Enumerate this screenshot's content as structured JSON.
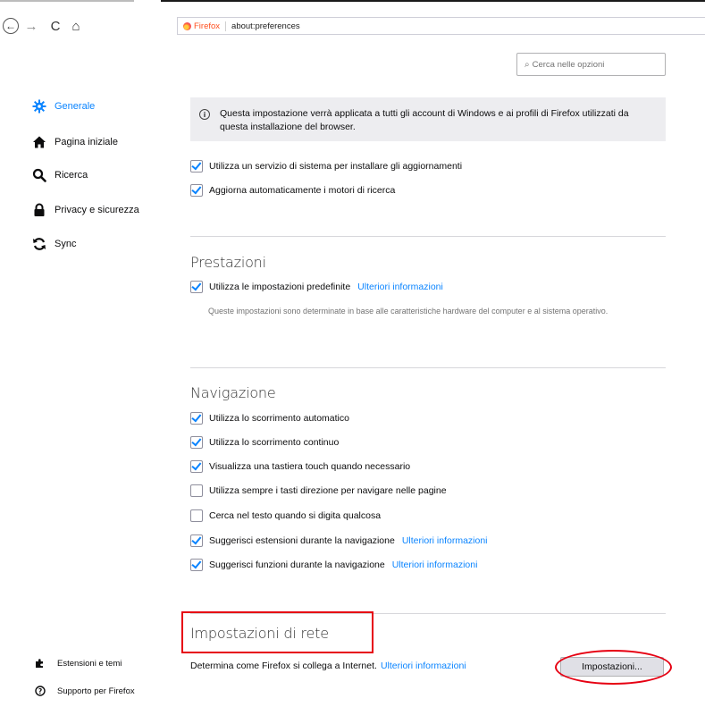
{
  "toolbar": {
    "back_glyph": "←",
    "forward_glyph": "→",
    "reload_glyph": "C",
    "home_glyph": "⌂",
    "browser_label": "Firefox",
    "url": "about:preferences"
  },
  "search": {
    "placeholder": "Cerca nelle opzioni",
    "icon": "search-icon"
  },
  "sidebar": {
    "items": [
      {
        "label": "Generale",
        "icon": "gear-icon",
        "active": true
      },
      {
        "label": "Pagina iniziale",
        "icon": "home-icon",
        "active": false
      },
      {
        "label": "Ricerca",
        "icon": "search-icon",
        "active": false
      },
      {
        "label": "Privacy e sicurezza",
        "icon": "lock-icon",
        "active": false
      },
      {
        "label": "Sync",
        "icon": "sync-icon",
        "active": false
      }
    ],
    "footer": [
      {
        "label": "Estensioni e temi",
        "icon": "puzzle-icon"
      },
      {
        "label": "Supporto per Firefox",
        "icon": "help-icon"
      }
    ]
  },
  "info": {
    "text": "Questa impostazione verrà applicata a tutti gli account di Windows e ai profili di Firefox utilizzati da questa installazione del browser."
  },
  "updates": {
    "items": [
      {
        "label": "Utilizza un servizio di sistema per installare gli aggiornamenti",
        "checked": true
      },
      {
        "label": "Aggiorna automaticamente i motori di ricerca",
        "checked": true
      }
    ]
  },
  "performance": {
    "title": "Prestazioni",
    "default_label": "Utilizza le impostazioni predefinite",
    "default_checked": true,
    "link": "Ulteriori informazioni",
    "note": "Queste impostazioni sono determinate in base alle caratteristiche hardware del computer e al sistema operativo."
  },
  "navigation": {
    "title": "Navigazione",
    "items": [
      {
        "label": "Utilizza lo scorrimento automatico",
        "checked": true,
        "link": ""
      },
      {
        "label": "Utilizza lo scorrimento continuo",
        "checked": true,
        "link": ""
      },
      {
        "label": "Visualizza una tastiera touch quando necessario",
        "checked": true,
        "link": ""
      },
      {
        "label": "Utilizza sempre i tasti direzione per navigare nelle pagine",
        "checked": false,
        "link": ""
      },
      {
        "label": "Cerca nel testo quando si digita qualcosa",
        "checked": false,
        "link": ""
      },
      {
        "label": "Suggerisci estensioni durante la navigazione",
        "checked": true,
        "link": "Ulteriori informazioni"
      },
      {
        "label": "Suggerisci funzioni durante la navigazione",
        "checked": true,
        "link": "Ulteriori informazioni"
      }
    ]
  },
  "network": {
    "title": "Impostazioni di rete",
    "description": "Determina come Firefox si collega a Internet.",
    "link": "Ulteriori informazioni",
    "button": "Impostazioni..."
  },
  "colors": {
    "accent": "#0a84ff",
    "highlight": "#e60012"
  }
}
